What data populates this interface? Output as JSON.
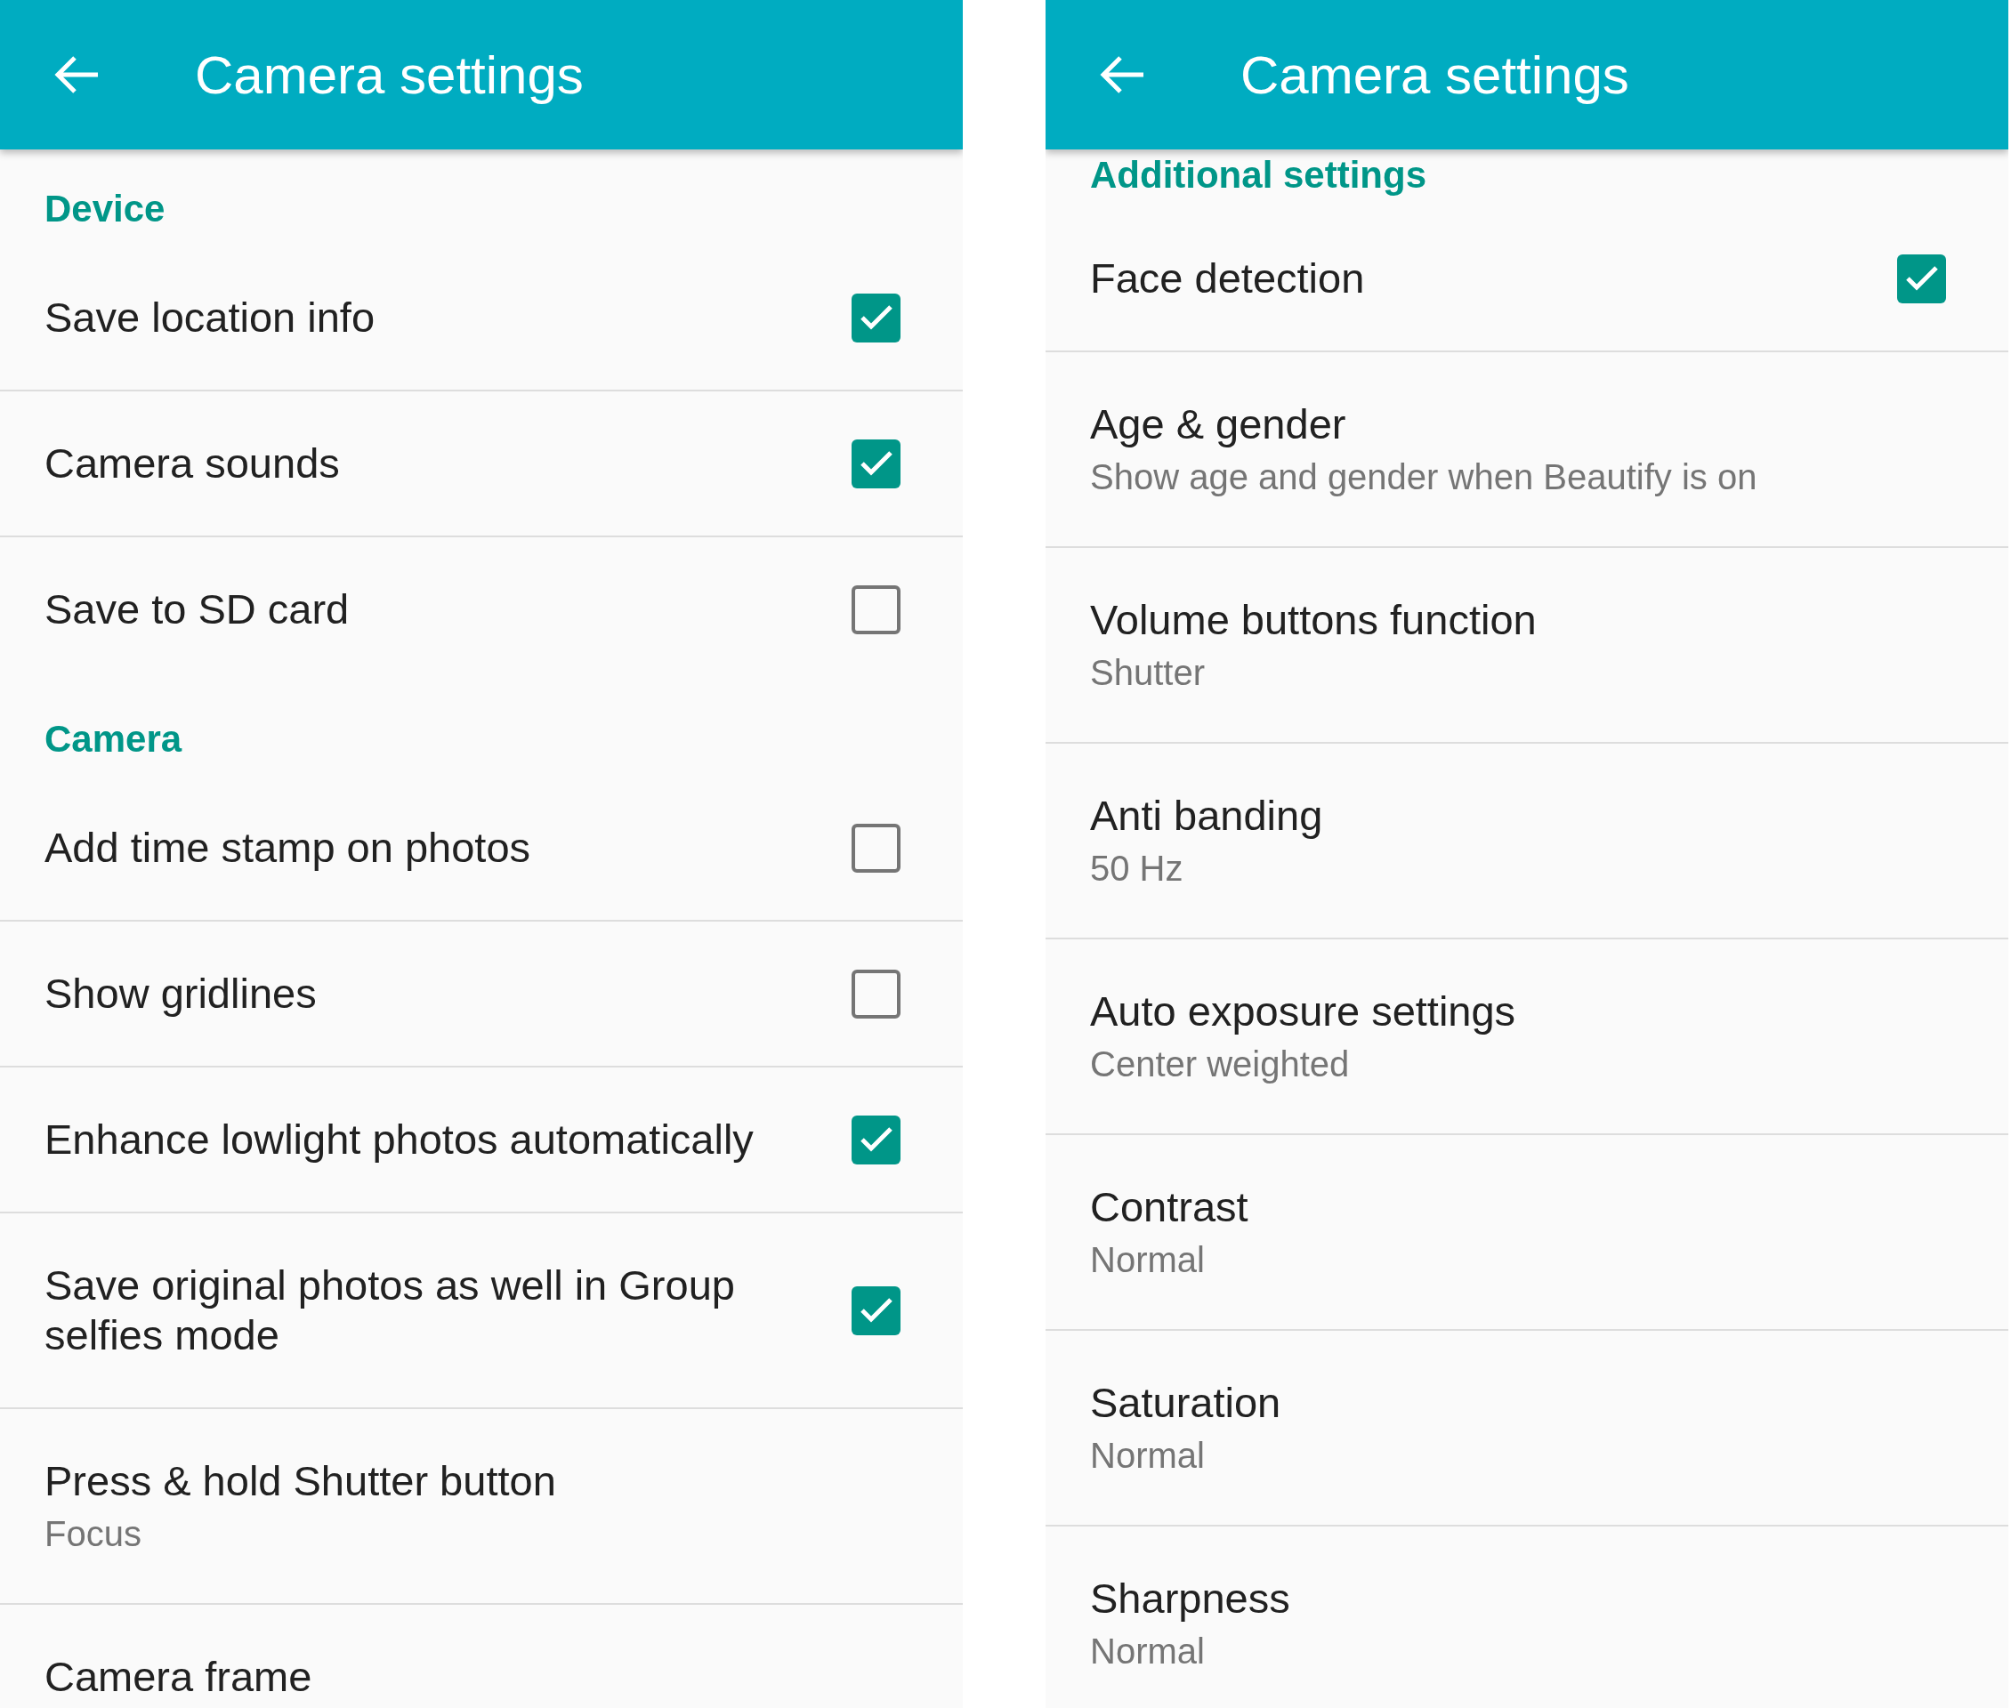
{
  "screens": [
    {
      "title": "Camera settings",
      "sections": [
        {
          "header": "Device",
          "items": [
            {
              "kind": "checkbox",
              "title": "Save location info",
              "checked": true
            },
            {
              "kind": "checkbox",
              "title": "Camera sounds",
              "checked": true
            },
            {
              "kind": "checkbox",
              "title": "Save to SD card",
              "checked": false
            }
          ]
        },
        {
          "header": "Camera",
          "items": [
            {
              "kind": "checkbox",
              "title": "Add time stamp on photos",
              "checked": false
            },
            {
              "kind": "checkbox",
              "title": "Show gridlines",
              "checked": false
            },
            {
              "kind": "checkbox",
              "title": "Enhance lowlight photos automatically",
              "checked": true
            },
            {
              "kind": "checkbox",
              "title": "Save original photos as well in Group selfies mode",
              "checked": true
            },
            {
              "kind": "value",
              "title": "Press & hold Shutter button",
              "subtitle": "Focus"
            },
            {
              "kind": "value",
              "title": "Camera frame"
            }
          ]
        }
      ]
    },
    {
      "title": "Camera settings",
      "sections": [
        {
          "header": "Additional settings",
          "items": [
            {
              "kind": "checkbox",
              "title": "Face detection",
              "checked": true
            },
            {
              "kind": "value",
              "title": "Age & gender",
              "subtitle": "Show age and gender when Beautify is on"
            },
            {
              "kind": "value",
              "title": "Volume buttons function",
              "subtitle": "Shutter"
            },
            {
              "kind": "value",
              "title": "Anti banding",
              "subtitle": "50 Hz"
            },
            {
              "kind": "value",
              "title": "Auto exposure settings",
              "subtitle": "Center weighted"
            },
            {
              "kind": "value",
              "title": "Contrast",
              "subtitle": "Normal"
            },
            {
              "kind": "value",
              "title": "Saturation",
              "subtitle": "Normal"
            },
            {
              "kind": "value",
              "title": "Sharpness",
              "subtitle": "Normal"
            }
          ]
        }
      ]
    }
  ]
}
